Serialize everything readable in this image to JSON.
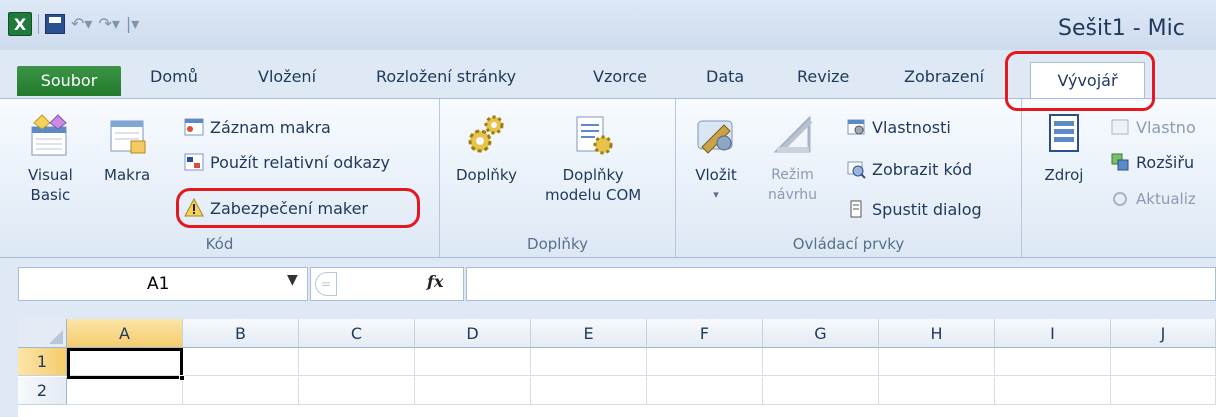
{
  "window": {
    "title": "Sešit1 - Mic"
  },
  "qat": {
    "app_icon": "X",
    "dropdown_glyph": "|▾"
  },
  "tabs": [
    {
      "label": "Soubor"
    },
    {
      "label": "Domů"
    },
    {
      "label": "Vložení"
    },
    {
      "label": "Rozložení stránky"
    },
    {
      "label": "Vzorce"
    },
    {
      "label": "Data"
    },
    {
      "label": "Revize"
    },
    {
      "label": "Zobrazení"
    },
    {
      "label": "Vývojář"
    }
  ],
  "ribbon": {
    "kod": {
      "label": "Kód",
      "visual_basic": [
        "Visual",
        "Basic"
      ],
      "makra": "Makra",
      "zaznam_makra": "Záznam makra",
      "relativni_odkazy": "Použít relativní odkazy",
      "zabezpeceni_maker": "Zabezpečení maker"
    },
    "doplnky": {
      "label": "Doplňky",
      "doplnky": "Doplňky",
      "doplnky_com": [
        "Doplňky",
        "modelu COM"
      ]
    },
    "ovladaci": {
      "label": "Ovládací prvky",
      "vlozit": "Vložit",
      "vlozit_arrow": "▾",
      "rezim": [
        "Režim",
        "návrhu"
      ],
      "vlastnosti": "Vlastnosti",
      "zobrazit_kod": "Zobrazit kód",
      "spustit_dialog": "Spustit dialog"
    },
    "xml": {
      "zdroj": "Zdroj",
      "vlastnosti": "Vlastno",
      "rozsireni": "Rozšiřu",
      "aktualizace": "Aktualiz"
    }
  },
  "formula_bar": {
    "name_box": "A1",
    "fx": "fx",
    "formula": ""
  },
  "sheet": {
    "columns": [
      "A",
      "B",
      "C",
      "D",
      "E",
      "F",
      "G",
      "H",
      "I",
      "J"
    ],
    "rows": [
      "1",
      "2"
    ],
    "selected_cell": "A1"
  },
  "colors": {
    "file_tab": "#217b2b",
    "highlight": "#e2191e",
    "active_header": "#f5cc6c"
  }
}
